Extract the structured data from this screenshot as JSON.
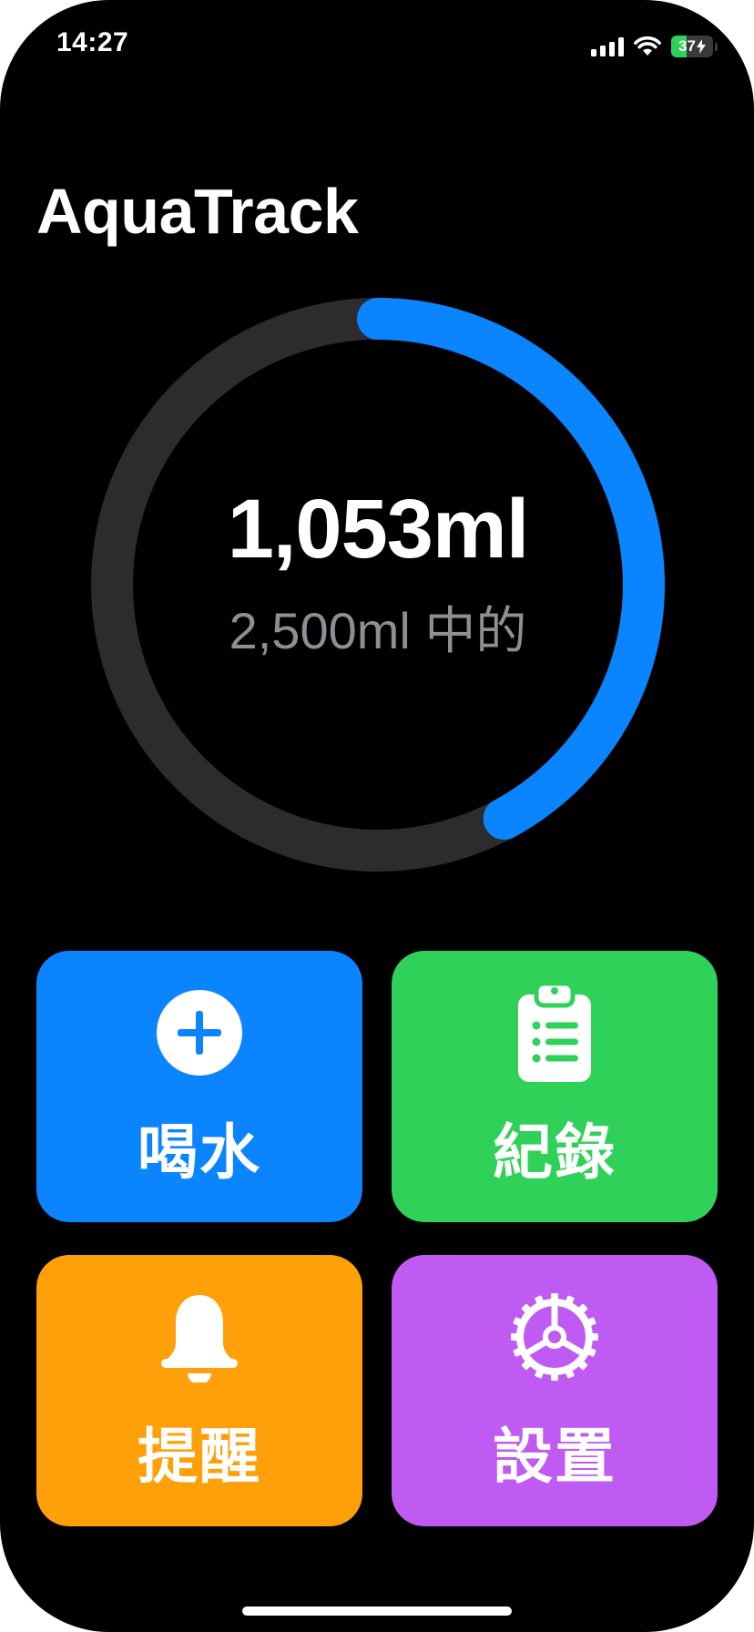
{
  "status_bar": {
    "time": "14:27",
    "battery_level": "37",
    "battery_fraction": 0.37,
    "battery_charging": true,
    "icons": [
      "signal-icon",
      "wifi-icon",
      "battery-icon"
    ]
  },
  "app": {
    "title": "AquaTrack"
  },
  "progress": {
    "intake_label": "1,053ml",
    "goal_label": "2,500ml 中的",
    "intake_ml": 1053,
    "goal_ml": 2500,
    "fraction": 0.4212,
    "track_color": "#2c2c2e",
    "fill_color": "#0a84ff"
  },
  "tiles": [
    {
      "label": "喝水",
      "icon": "plus-circle-icon",
      "color": "#0a84ff"
    },
    {
      "label": "紀錄",
      "icon": "clipboard-list-icon",
      "color": "#30d158"
    },
    {
      "label": "提醒",
      "icon": "bell-icon",
      "color": "#ff9f0a"
    },
    {
      "label": "設置",
      "icon": "gear-icon",
      "color": "#bf5af2"
    }
  ]
}
